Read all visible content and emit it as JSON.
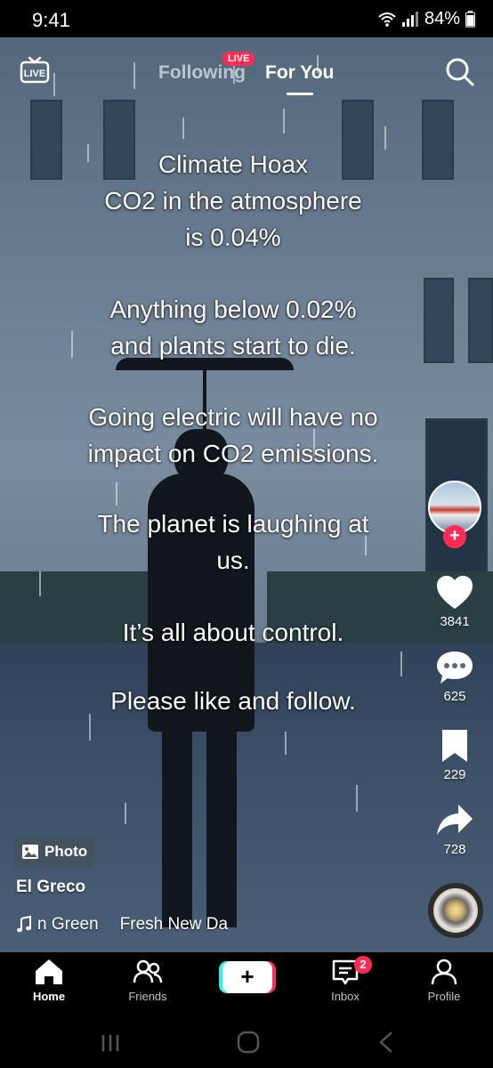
{
  "status_bar": {
    "time": "9:41",
    "battery": "84%"
  },
  "top_nav": {
    "following_label": "Following",
    "live_badge": "LIVE",
    "for_you_label": "For You",
    "live_icon_label": "LIVE"
  },
  "caption": {
    "lines": [
      "Climate Hoax",
      "CO2 in the atmosphere",
      "is 0.04%",
      "Anything below 0.02%",
      "and plants start to die.",
      "Going electric will have no",
      "impact on CO2 emissions.",
      "The planet is laughing at",
      "us.",
      "It’s all about control.",
      "Please like and follow."
    ]
  },
  "actions": {
    "likes": "3841",
    "comments": "625",
    "saves": "229",
    "shares": "728"
  },
  "post": {
    "photo_label": "Photo",
    "author": "El Greco",
    "music_1": "n Green",
    "music_2": "Fresh New Da"
  },
  "bottom_nav": {
    "home": "Home",
    "friends": "Friends",
    "inbox": "Inbox",
    "inbox_badge": "2",
    "profile": "Profile"
  },
  "colors": {
    "accent": "#fe2c55",
    "cyan": "#25f4ee"
  }
}
